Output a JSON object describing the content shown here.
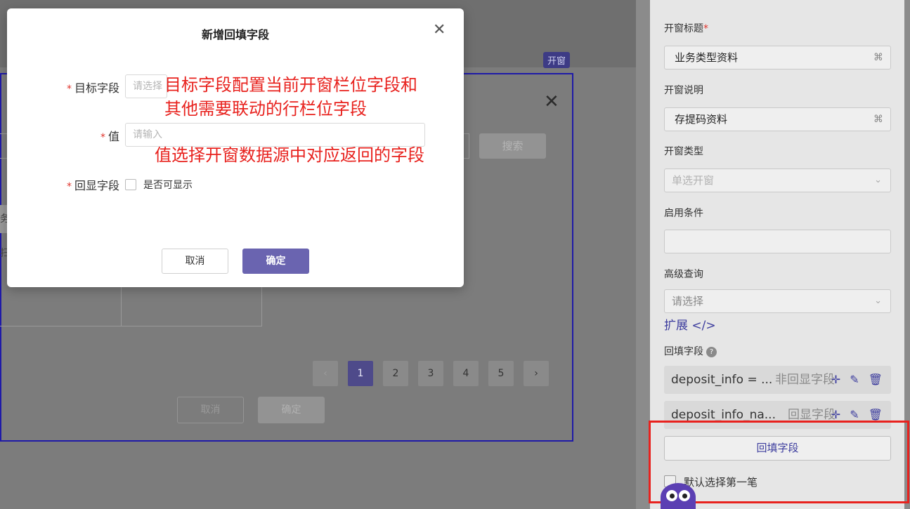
{
  "canvas": {
    "preview_tag": "开窗",
    "close_glyph": "✕",
    "search_button": "搜索",
    "row_chip": "务",
    "row_chip2": "扫",
    "pagination": {
      "prev": "‹",
      "pages": [
        "1",
        "2",
        "3",
        "4",
        "5"
      ],
      "active": "1",
      "next": "›"
    },
    "cancel": "取消",
    "confirm": "确定"
  },
  "modal": {
    "title": "新增回填字段",
    "close_glyph": "✕",
    "target_field_label": "目标字段",
    "target_field_placeholder": "请选择",
    "value_label": "值",
    "value_placeholder": "请输入",
    "display_field_label": "回显字段",
    "display_checkbox_label": "是否可显示",
    "cancel": "取消",
    "confirm": "确定"
  },
  "annotations": {
    "line1": "目标字段配置当前开窗栏位字段和",
    "line2": "其他需要联动的行栏位字段",
    "line3": "值选择开窗数据源中对应返回的字段"
  },
  "panel": {
    "window_title_label": "开窗标题",
    "window_title_value": "业务类型资料",
    "window_desc_label": "开窗说明",
    "window_desc_value": "存提码资料",
    "window_type_label": "开窗类型",
    "window_type_value": "单选开窗",
    "enable_cond_label": "启用条件",
    "adv_query_label": "高级查询",
    "adv_query_placeholder": "请选择",
    "expand_link": "扩展 </>",
    "backfill_label": "回填字段",
    "help_glyph": "?",
    "translate_glyph": "⌘",
    "chevron_glyph": "⌄",
    "rules": [
      {
        "name": "deposit_info = ...",
        "kind": "非回显字段"
      },
      {
        "name": "deposit_info_na...",
        "kind": "回显字段"
      }
    ],
    "rule_icons": "✛ ✎ 🗑",
    "add_backfill_button": "回填字段",
    "default_first_label": "默认选择第一笔"
  }
}
